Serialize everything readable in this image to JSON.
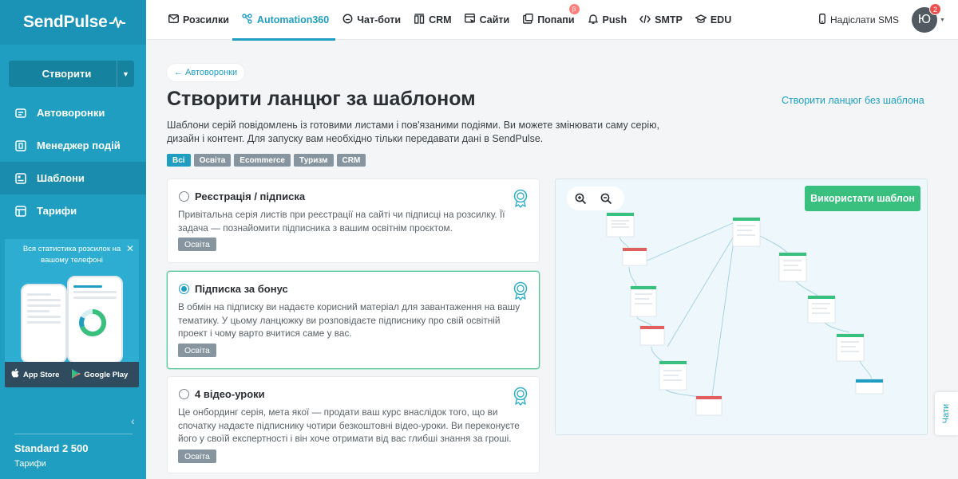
{
  "brand": {
    "name": "SendPulse"
  },
  "sidebar": {
    "create_label": "Створити",
    "items": [
      {
        "label": "Автоворонки",
        "icon": "funnel-icon"
      },
      {
        "label": "Менеджер подій",
        "icon": "events-icon"
      },
      {
        "label": "Шаблони",
        "icon": "templates-icon"
      },
      {
        "label": "Тарифи",
        "icon": "pricing-icon"
      }
    ],
    "promo": {
      "text": "Вся статистика розсилок на вашому телефоні",
      "app_store": "App Store",
      "google_play": "Google Play"
    },
    "plan": {
      "name": "Standard 2 500",
      "sub": "Тарифи"
    }
  },
  "topnav": {
    "tabs": [
      {
        "label": "Розсилки",
        "icon": "mail-icon"
      },
      {
        "label": "Automation360",
        "icon": "automation-icon"
      },
      {
        "label": "Чат-боти",
        "icon": "chat-icon"
      },
      {
        "label": "CRM",
        "icon": "crm-icon"
      },
      {
        "label": "Сайти",
        "icon": "sites-icon"
      },
      {
        "label": "Попапи",
        "icon": "popups-icon",
        "badge": "β"
      },
      {
        "label": "Push",
        "icon": "bell-icon"
      },
      {
        "label": "SMTP",
        "icon": "code-icon"
      },
      {
        "label": "EDU",
        "icon": "graduation-icon"
      }
    ],
    "active_tab": "Automation360",
    "sms_label": "Надіслати SMS",
    "avatar_letter": "Ю",
    "notifications": "2"
  },
  "main": {
    "back_label": "← Автоворонки",
    "title": "Створити ланцюг за шаблоном",
    "no_template_link": "Створити ланцюг без шаблона",
    "description": "Шаблони серій повідомлень із готовими листами і пов'язаними подіями. Ви можете змінювати саму серію, дизайн і контент. Для запуску вам необхідно тільки передавати дані в SendPulse.",
    "filters": [
      "Всі",
      "Освіта",
      "Ecommerce",
      "Туризм",
      "CRM"
    ],
    "active_filter": "Всі",
    "templates": [
      {
        "title": "Реєстрація / підписка",
        "text": "Привітальна серія листів при реєстрації на сайті чи підписці на розсилку. Її задача — познайомити підписника з вашим освітнім проєктом.",
        "tag": "Освіта",
        "selected": false
      },
      {
        "title": "Підписка за бонус",
        "text": "В обмін на підписку ви надаєте корисний матеріал для завантаження на вашу тематику. У цьому ланцюжку ви розповідаєте підписнику про свій освітній проект і чому варто вчитися саме у вас.",
        "tag": "Освіта",
        "selected": true
      },
      {
        "title": "4 відео-уроки",
        "text": "Це онбординг серія, мета якої — продати ваш курс внаслідок того, що ви спочатку надаєте підписнику чотири безкоштовні відео-уроки. Ви переконуєте його у своїй експертності і він хоче отримати від вас глибші знання за гроші.",
        "tag": "Освіта",
        "selected": false
      }
    ],
    "use_template_label": "Використати шаблон"
  },
  "chats_label": "Чати",
  "colors": {
    "accent": "#1f9ec2",
    "green": "#39c07f",
    "sidebar": "#1f9ec2",
    "tag": "#86959f"
  }
}
